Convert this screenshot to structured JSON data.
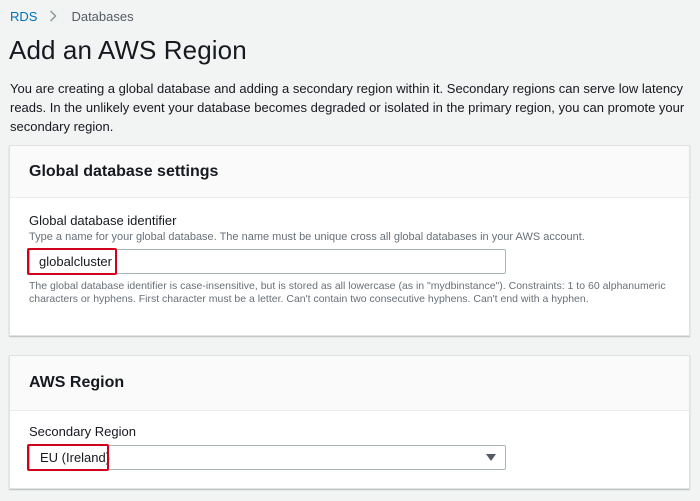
{
  "breadcrumb": {
    "root": "RDS",
    "current": "Databases"
  },
  "page": {
    "title": "Add an AWS Region",
    "description": "You are creating a global database and adding a secondary region within it. Secondary regions can serve low latency reads. In the unlikely event your database becomes degraded or isolated in the primary region, you can promote your secondary region."
  },
  "global_settings": {
    "heading": "Global database settings",
    "identifier_label": "Global database identifier",
    "identifier_hint": "Type a name for your global database. The name must be unique cross all global databases in your AWS account.",
    "identifier_value": "globalcluster",
    "identifier_constraint": "The global database identifier is case-insensitive, but is stored as all lowercase (as in \"mydbinstance\"). Constraints: 1 to 60 alphanumeric characters or hyphens. First character must be a letter. Can't contain two consecutive hyphens. Can't end with a hyphen."
  },
  "aws_region": {
    "heading": "AWS Region",
    "secondary_label": "Secondary Region",
    "secondary_value": "EU (Ireland)"
  },
  "colors": {
    "link": "#0073bb",
    "highlight": "#d0021b",
    "background": "#f2f3f3"
  },
  "icons": {
    "breadcrumb_separator": "chevron-right-icon",
    "select_caret": "caret-down-icon"
  }
}
